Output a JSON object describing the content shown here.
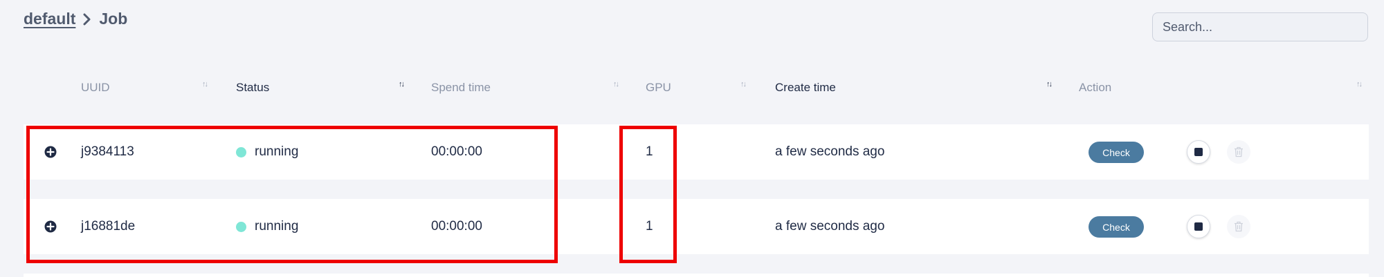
{
  "breadcrumb": {
    "parent": "default",
    "current": "Job"
  },
  "search": {
    "placeholder": "Search..."
  },
  "table": {
    "columns": {
      "uuid": "UUID",
      "status": "Status",
      "spend_time": "Spend time",
      "gpu": "GPU",
      "create_time": "Create time",
      "action": "Action"
    },
    "active_sort_columns": [
      "status",
      "create_time"
    ],
    "rows": [
      {
        "uuid": "j9384113",
        "status": "running",
        "spend_time": "00:00:00",
        "gpu": "1",
        "create_time": "a few seconds ago",
        "check_label": "Check"
      },
      {
        "uuid": "j16881de",
        "status": "running",
        "spend_time": "00:00:00",
        "gpu": "1",
        "create_time": "a few seconds ago",
        "check_label": "Check"
      }
    ]
  },
  "colors": {
    "background": "#f3f4f8",
    "running_status": "#7fe6d6",
    "check_button": "#4b7ba0",
    "highlight": "#ee0000"
  },
  "icons": {
    "breadcrumb_separator": "chevron-right-icon",
    "sort": "sort-arrows-icon",
    "expand": "plus-circle-icon",
    "stop": "stop-icon",
    "delete": "trash-icon"
  }
}
